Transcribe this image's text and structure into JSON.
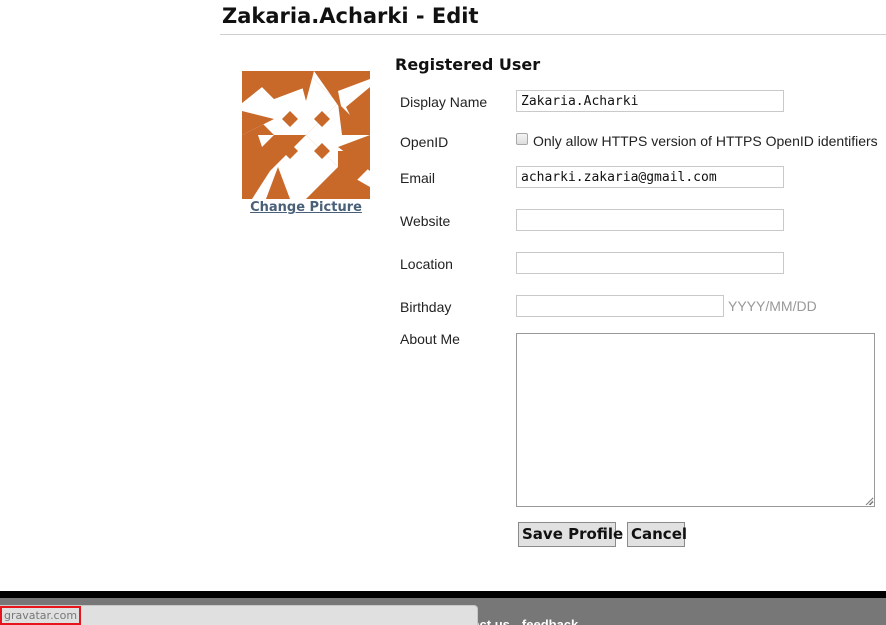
{
  "page": {
    "title": "Zakaria.Acharki - Edit"
  },
  "avatar": {
    "icon": "identicon-avatar",
    "color": "#C8692A",
    "change_picture_label": "Change Picture"
  },
  "form": {
    "heading": "Registered User",
    "fields": {
      "display_name": {
        "label": "Display Name",
        "value": "Zakaria.Acharki"
      },
      "openid": {
        "label": "OpenID",
        "checkbox_label": "Only allow HTTPS version of HTTPS OpenID identifiers",
        "checked": false
      },
      "email": {
        "label": "Email",
        "value": "acharki.zakaria@gmail.com"
      },
      "website": {
        "label": "Website",
        "value": ""
      },
      "location": {
        "label": "Location",
        "value": ""
      },
      "birthday": {
        "label": "Birthday",
        "value": "",
        "hint": "YYYY/MM/DD"
      },
      "about_me": {
        "label": "About Me",
        "value": ""
      }
    },
    "buttons": {
      "save": "Save Profile",
      "cancel": "Cancel"
    }
  },
  "footer": {
    "links": [
      "contact us",
      "feedback"
    ],
    "visible_link_text": [
      "tact us",
      "feedback"
    ]
  },
  "status_bar": {
    "url_text": "gravatar.com",
    "highlight_color": "#E8141C"
  }
}
